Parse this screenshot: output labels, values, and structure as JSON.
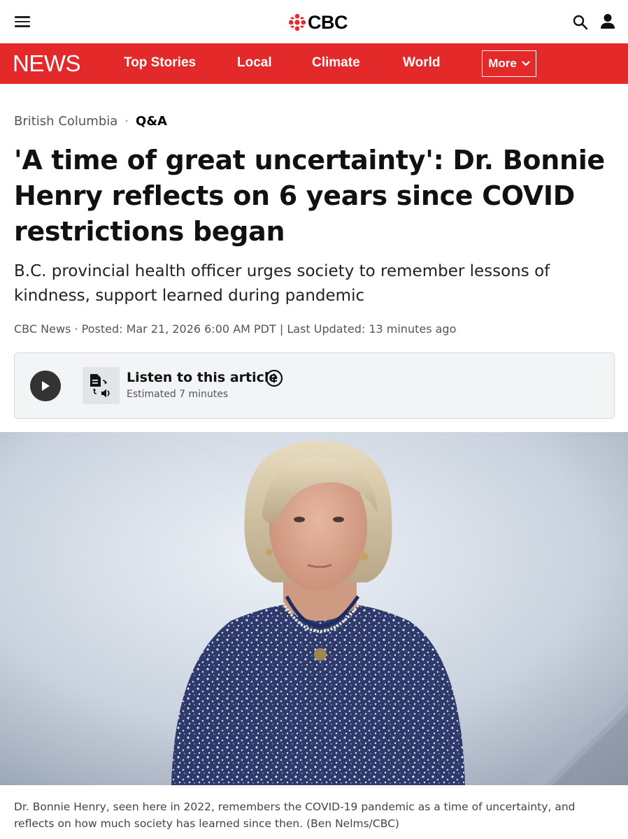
{
  "header": {
    "logo_text": "CBC",
    "menu_icon": "hamburger-menu-icon",
    "search_icon": "search-icon",
    "account_icon": "user-icon"
  },
  "nav": {
    "brand": "NEWS",
    "items": [
      "Top Stories",
      "Local",
      "Climate",
      "World"
    ],
    "more_label": "More"
  },
  "article": {
    "section": "British Columbia",
    "separator": "·",
    "type": "Q&A",
    "headline": "'A time of great uncertainty': Dr. Bonnie Henry reflects on 6 years since COVID restrictions began",
    "deck": "B.C. provincial health officer urges society to remember lessons of kindness, support learned during pandemic",
    "byline": "CBC News · Posted: Mar 21, 2026 6:00 AM PDT | Last Updated: 13 minutes ago"
  },
  "audio_player": {
    "title": "Listen to this article",
    "estimate": "Estimated 7 minutes"
  },
  "image": {
    "caption": "Dr. Bonnie Henry, seen here in 2022, remembers the COVID-19 pandemic as a time of uncertainty, and reflects on how much society has learned since then. (Ben Nelms/CBC)"
  },
  "colors": {
    "brand_red": "#e3292a",
    "player_bg": "#f3f4f6"
  }
}
